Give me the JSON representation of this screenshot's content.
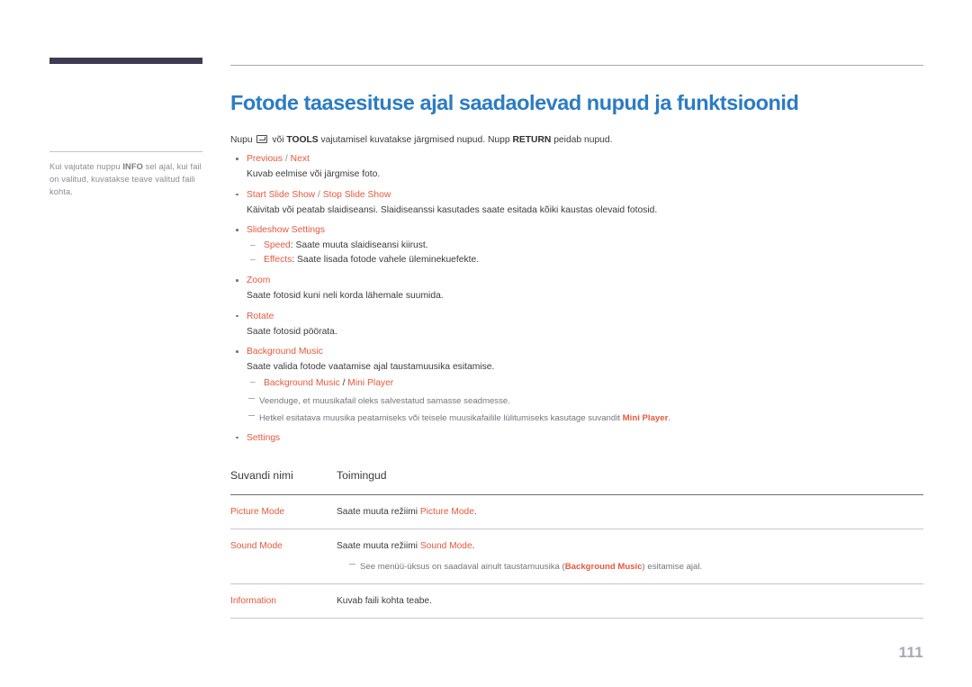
{
  "page": {
    "title": "Fotode taasesituse ajal saadaolevad nupud ja funktsioonid",
    "number": "111",
    "accent_color": "#e8583c",
    "title_color": "#2b7cc4",
    "sidebar_bar_color": "#3e3b52"
  },
  "sidebar": {
    "note_before": "Kui vajutate nuppu ",
    "note_bold": "INFO",
    "note_after": " sel ajal, kui fail on valitud, kuvatakse teave valitud faili kohta."
  },
  "intro": {
    "part1": "Nupu ",
    "key_icon": "return-key-icon",
    "part2": " või ",
    "bold1": "TOOLS",
    "part3": " vajutamisel kuvatakse järgmised nupud. Nupp ",
    "bold2": "RETURN",
    "part4": " peidab nupud."
  },
  "bullets": [
    {
      "head_a": "Previous",
      "sep": " / ",
      "head_b": "Next",
      "desc": "Kuvab eelmise või järgmise foto."
    },
    {
      "head_a": "Start Slide Show",
      "sep": " / ",
      "head_b": "Stop Slide Show",
      "desc": "Käivitab või peatab slaidiseansi. Slaidiseanssi kasutades saate esitada kõiki kaustas olevaid fotosid."
    },
    {
      "head_a": "Slideshow Settings",
      "sub": [
        {
          "term": "Speed",
          "text": ": Saate muuta slaidiseansi kiirust."
        },
        {
          "term": "Effects",
          "text": ": Saate lisada fotode vahele üleminekuefekte."
        }
      ]
    },
    {
      "head_a": "Zoom",
      "desc": "Saate fotosid kuni neli korda lähemale suumida."
    },
    {
      "head_a": "Rotate",
      "desc": "Saate fotosid pöörata."
    },
    {
      "head_a": "Background Music",
      "desc": "Saate valida fotode vaatamise ajal taustamuusika esitamise.",
      "sub_plain": [
        {
          "term_a": "Background Music",
          "sep": " / ",
          "term_b": "Mini Player"
        }
      ],
      "notes": [
        {
          "text": "Veenduge, et muusikafail oleks salvestatud samasse seadmesse."
        },
        {
          "pre": "Hetkel esitatava muusika peatamiseks või teisele muusikafailile lülitumiseks kasutage suvandit ",
          "bold": "Mini Player",
          "post": "."
        }
      ]
    },
    {
      "head_a": "Settings"
    }
  ],
  "table": {
    "headers": [
      "Suvandi nimi",
      "Toimingud"
    ],
    "rows": [
      {
        "name": "Picture Mode",
        "action_pre": "Saate muuta režiimi ",
        "action_accent": "Picture Mode",
        "action_post": "."
      },
      {
        "name": "Sound Mode",
        "action_pre": "Saate muuta režiimi ",
        "action_accent": "Sound Mode",
        "action_post": ".",
        "note_pre": "See menüü-üksus on saadaval ainult taustamuusika (",
        "note_bold": "Background Music",
        "note_post": ") esitamise ajal."
      },
      {
        "name": "Information",
        "action_pre": "Kuvab faili kohta teabe.",
        "action_accent": "",
        "action_post": ""
      }
    ]
  }
}
